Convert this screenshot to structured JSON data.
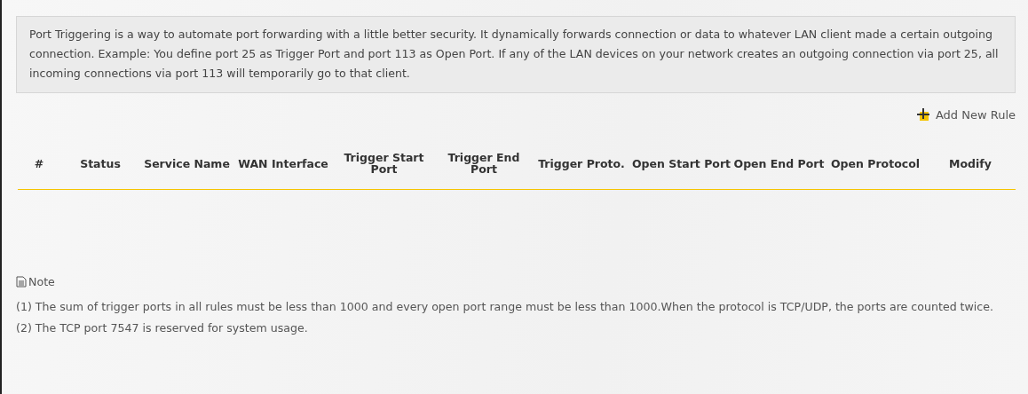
{
  "description": "Port Triggering is a way to automate port forwarding with a little better security. It dynamically forwards connection or data to whatever LAN client made a certain outgoing connection. Example: You define port 25 as Trigger Port and port 113 as Open Port. If any of the LAN devices on your network creates an outgoing connection via port 25, all incoming connections via port 113 will temporarily go to that client.",
  "add_button": {
    "label": "Add New Rule"
  },
  "table": {
    "columns": [
      {
        "label": "#"
      },
      {
        "label": "Status"
      },
      {
        "label": "Service Name"
      },
      {
        "label": "WAN Interface"
      },
      {
        "label": "Trigger Start Port"
      },
      {
        "label": "Trigger End Port"
      },
      {
        "label": "Trigger Proto."
      },
      {
        "label": "Open Start Port"
      },
      {
        "label": "Open End Port"
      },
      {
        "label": "Open Protocol"
      },
      {
        "label": "Modify"
      }
    ]
  },
  "note": {
    "title": "Note",
    "items": [
      "(1) The sum of trigger ports in all rules must be less than 1000 and every open port range must be less than 1000.When the protocol is TCP/UDP, the ports are counted twice.",
      "(2) The TCP port 7547 is reserved for system usage."
    ]
  }
}
